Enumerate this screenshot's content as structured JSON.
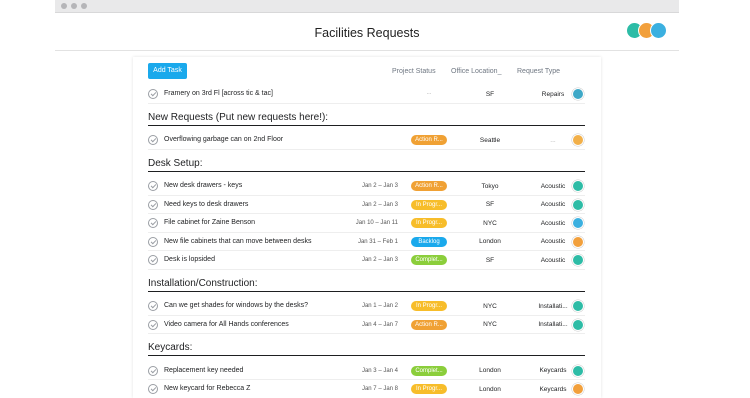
{
  "window": {
    "title": "Facilities Requests"
  },
  "toolbar": {
    "add_task_label": "Add Task"
  },
  "columns": {
    "status": "Project Status",
    "location": "Office Location_",
    "type": "Request Type"
  },
  "colors": {
    "orange": "#f0a134",
    "yellow": "#f7bd2a",
    "blue": "#1aa9ec",
    "green": "#8bce3b",
    "muted_text": "#6f7782"
  },
  "members": [
    {
      "icon": "avatar-teal",
      "color": "#2dbca6"
    },
    {
      "icon": "avatar-orange",
      "color": "#f2a03c"
    },
    {
      "icon": "avatar-blue",
      "color": "#3bb0e0"
    }
  ],
  "rows_top": [
    {
      "name": "Framery on 3rd Fl [across tic & tac]",
      "date": "",
      "status": "...",
      "location": "SF",
      "type": "Repairs",
      "avatar_color": "#3ea8c7"
    }
  ],
  "sections": [
    {
      "title": "New Requests (Put new requests here!):",
      "rows": [
        {
          "name": "Overflowing garbage can on 2nd Floor",
          "date": "",
          "status": "Action R...",
          "status_color": "#f0a134",
          "location": "Seattle",
          "type": "...",
          "avatar_color": "#f2b04a"
        }
      ]
    },
    {
      "title": "Desk Setup:",
      "rows": [
        {
          "name": "New desk drawers - keys",
          "date": "Jan 2 – Jan 3",
          "status": "Action R...",
          "status_color": "#f0a134",
          "location": "Tokyo",
          "type": "Acoustic",
          "avatar_color": "#2dbca6"
        },
        {
          "name": "Need keys to desk drawers",
          "date": "Jan 2 – Jan 3",
          "status": "In Progr...",
          "status_color": "#f7bd2a",
          "location": "SF",
          "type": "Acoustic",
          "avatar_color": "#2dbca6"
        },
        {
          "name": "File cabinet for Zaine Benson",
          "date": "Jan 10 – Jan 11",
          "status": "In Progr...",
          "status_color": "#f7bd2a",
          "location": "NYC",
          "type": "Acoustic",
          "avatar_color": "#3bb0e0"
        },
        {
          "name": "New file cabinets that can move between desks",
          "date": "Jan 31 – Feb 1",
          "status": "Backlog",
          "status_color": "#1aa9ec",
          "location": "London",
          "type": "Acoustic",
          "avatar_color": "#f2a03c"
        },
        {
          "name": "Desk is lopsided",
          "date": "Jan 2 – Jan 3",
          "status": "Complet...",
          "status_color": "#8bce3b",
          "location": "SF",
          "type": "Acoustic",
          "avatar_color": "#2dbca6"
        }
      ]
    },
    {
      "title": "Installation/Construction:",
      "rows": [
        {
          "name": "Can we get shades for windows by the desks?",
          "date": "Jan 1 – Jan 2",
          "status": "In Progr...",
          "status_color": "#f7bd2a",
          "location": "NYC",
          "type": "Installati...",
          "avatar_color": "#2dbca6"
        },
        {
          "name": "Video camera for All Hands conferences",
          "date": "Jan 4 – Jan 7",
          "status": "Action R...",
          "status_color": "#f0a134",
          "location": "NYC",
          "type": "Installati...",
          "avatar_color": "#2dbca6"
        }
      ]
    },
    {
      "title": "Keycards:",
      "rows": [
        {
          "name": "Replacement key needed",
          "date": "Jan 3 – Jan 4",
          "status": "Complet...",
          "status_color": "#8bce3b",
          "location": "London",
          "type": "Keycards",
          "avatar_color": "#2dbca6"
        },
        {
          "name": "New keycard for Rebecca Z",
          "date": "Jan 7 – Jan 8",
          "status": "In Progr...",
          "status_color": "#f7bd2a",
          "location": "London",
          "type": "Keycards",
          "avatar_color": "#f2a03c"
        }
      ]
    }
  ]
}
